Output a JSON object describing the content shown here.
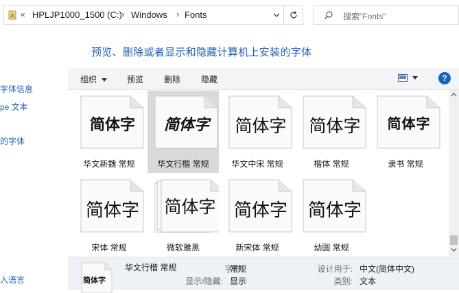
{
  "address": {
    "crumbs": [
      "HPLJP1000_1500 (C:)",
      "Windows",
      "Fonts"
    ],
    "overflow": "«"
  },
  "search": {
    "placeholder": "搜索\"Fonts\""
  },
  "heading": "预览、删除或者显示和隐藏计算机上安装的字体",
  "left_nav": [
    "字体信息",
    "pe 文本",
    "的字体",
    "入语言"
  ],
  "toolbar": {
    "organize": "组织",
    "preview": "预览",
    "delete": "删除",
    "hide": "隐藏",
    "help": "?"
  },
  "fonts": [
    {
      "name": "华文新魏 常规",
      "sample": "简体字",
      "selected": false,
      "family": false
    },
    {
      "name": "华文行楷 常规",
      "sample": "简体字",
      "selected": true,
      "family": false
    },
    {
      "name": "华文中宋 常规",
      "sample": "简体字",
      "selected": false,
      "family": false
    },
    {
      "name": "楷体 常规",
      "sample": "简体字",
      "selected": false,
      "family": false
    },
    {
      "name": "隶书 常规",
      "sample": "简体字",
      "selected": false,
      "family": false
    },
    {
      "name": "宋体 常规",
      "sample": "简体字",
      "selected": false,
      "family": false
    },
    {
      "name": "微软雅黑",
      "sample": "简体字",
      "selected": false,
      "family": true
    },
    {
      "name": "新宋体 常规",
      "sample": "简体字",
      "selected": false,
      "family": false
    },
    {
      "name": "幼圆 常规",
      "sample": "简体字",
      "selected": false,
      "family": false
    }
  ],
  "details": {
    "title": "华文行楷 常规",
    "sample": "简体字",
    "style_label": "字形:",
    "style_value": "常规",
    "show_label": "显示/隐藏:",
    "show_value": "显示",
    "designed_label": "设计用于:",
    "designed_value": "中文(简体中文)",
    "category_label": "类别:",
    "category_value": "文本"
  },
  "colors": {
    "link": "#1e5eb8",
    "selected_tile": "#d9d9d9",
    "toolbar_bg": "#f2f4f7",
    "details_bg": "#eef2f6"
  },
  "icons": [
    "drive-icon",
    "chevron-down-icon",
    "refresh-icon",
    "search-icon",
    "view-icon",
    "help-icon",
    "font-document-icon"
  ]
}
